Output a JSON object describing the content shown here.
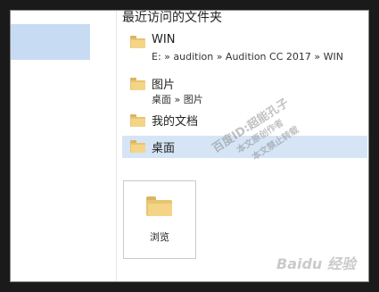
{
  "recent_folders": {
    "title": "最近访问的文件夹",
    "items": [
      {
        "name": "WIN",
        "path": "E: » audition » Audition CC 2017 » WIN"
      },
      {
        "name": "图片",
        "path": "桌面 » 图片"
      },
      {
        "name": "我的文档",
        "path": ""
      },
      {
        "name": "桌面",
        "path": ""
      }
    ]
  },
  "browse": {
    "label": "浏览"
  },
  "watermark": {
    "line1": "百度ID:超能孔子",
    "line2": "本文原创作者",
    "line3": "本文禁止转载"
  },
  "baidu_mark": "Baidu 经验",
  "colors": {
    "selection": "#d6e5f6",
    "nav_selection": "#c7dcf3",
    "folder": "#f4d587"
  }
}
